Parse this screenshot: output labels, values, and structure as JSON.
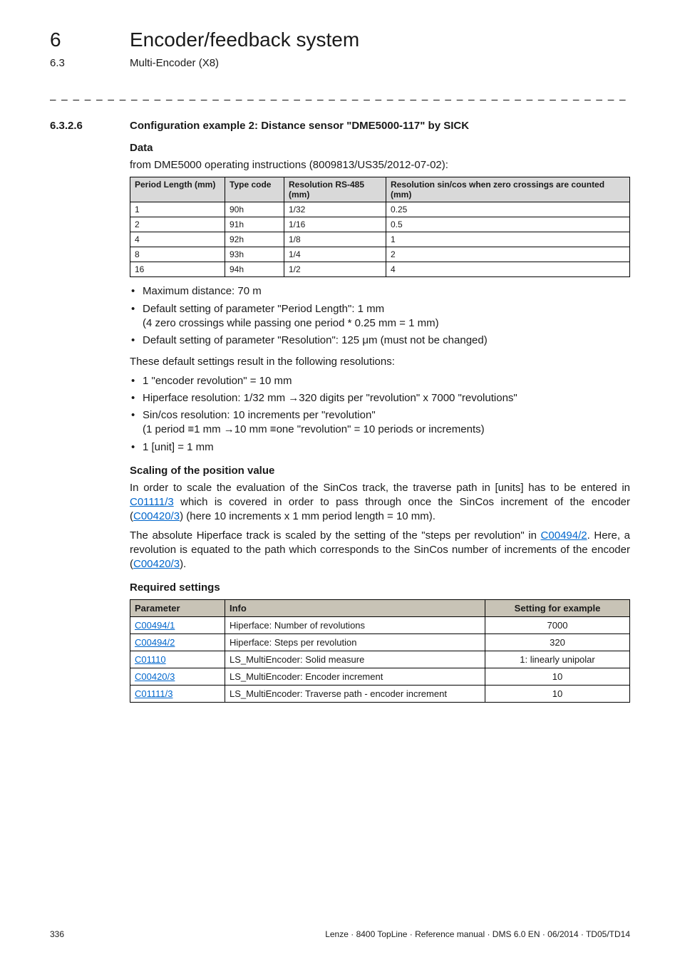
{
  "header": {
    "chapter_num": "6",
    "chapter_title": "Encoder/feedback system",
    "sub_num": "6.3",
    "sub_title": "Multi-Encoder (X8)"
  },
  "section": {
    "num": "6.3.2.6",
    "title": "Configuration example 2: Distance sensor \"DME5000-117\" by SICK"
  },
  "data_heading": "Data",
  "data_intro": "from DME5000 operating instructions (8009813/US35/2012-07-02):",
  "table1": {
    "headers": [
      "Period Length (mm)",
      "Type code",
      "Resolution RS-485 (mm)",
      "Resolution sin/cos when zero crossings are counted (mm)"
    ],
    "rows": [
      [
        "1",
        "90h",
        "1/32",
        "0.25"
      ],
      [
        "2",
        "91h",
        "1/16",
        "0.5"
      ],
      [
        "4",
        "92h",
        "1/8",
        "1"
      ],
      [
        "8",
        "93h",
        "1/4",
        "2"
      ],
      [
        "16",
        "94h",
        "1/2",
        "4"
      ]
    ]
  },
  "bullets_a": {
    "b0": "Maximum distance: 70 m",
    "b1": "Default setting of parameter \"Period Length\": 1 mm",
    "b1_sub": "(4 zero crossings while passing one period * 0.25 mm = 1 mm)",
    "b2": "Default setting of parameter \"Resolution\": 125 μm (must not be changed)"
  },
  "para_defaults": "These default settings result in the following resolutions:",
  "bullets_b": {
    "b0": "1 \"encoder revolution\" = 10 mm",
    "b1_pre": "Hiperface resolution: 1/32 mm",
    "b1_post": "320 digits per \"revolution\" x 7000 \"revolutions\"",
    "b2": "Sin/cos resolution: 10 increments per \"revolution\"",
    "b2_sub_a": "(1 period",
    "b2_sub_b": "1 mm",
    "b2_sub_c": "10 mm",
    "b2_sub_d": "one \"revolution\" = 10 periods or increments)",
    "b3": "1 [unit] = 1 mm"
  },
  "scaling_heading": "Scaling of the position value",
  "scaling_p1_a": "In order to scale the evaluation of the SinCos track, the traverse path in [units] has to be entered in ",
  "scaling_link1": "C01111/3",
  "scaling_p1_b": " which is covered in order to pass through once the SinCos increment of the encoder (",
  "scaling_link2": "C00420/3",
  "scaling_p1_c": ") (here 10 increments x 1 mm period length = 10 mm).",
  "scaling_p2_a": "The absolute Hiperface track is scaled by the setting of the \"steps per revolution\" in ",
  "scaling_link3": "C00494/2",
  "scaling_p2_b": ". Here, a revolution is equated to the path which corresponds to the SinCos number of increments of the encoder (",
  "scaling_link4": "C00420/3",
  "scaling_p2_c": ").",
  "req_heading": "Required settings",
  "table2": {
    "headers": [
      "Parameter",
      "Info",
      "Setting for example"
    ],
    "rows": [
      {
        "param": "C00494/1",
        "info": "Hiperface: Number of revolutions",
        "setting": "7000"
      },
      {
        "param": "C00494/2",
        "info": "Hiperface: Steps per revolution",
        "setting": "320"
      },
      {
        "param": "C01110",
        "info": "LS_MultiEncoder: Solid measure",
        "setting": "1: linearly unipolar"
      },
      {
        "param": "C00420/3",
        "info": "LS_MultiEncoder: Encoder increment",
        "setting": "10"
      },
      {
        "param": "C01111/3",
        "info": "LS_MultiEncoder: Traverse path - encoder increment",
        "setting": "10"
      }
    ]
  },
  "footer": {
    "page": "336",
    "right": "Lenze · 8400 TopLine · Reference manual · DMS 6.0 EN · 06/2014 · TD05/TD14"
  }
}
